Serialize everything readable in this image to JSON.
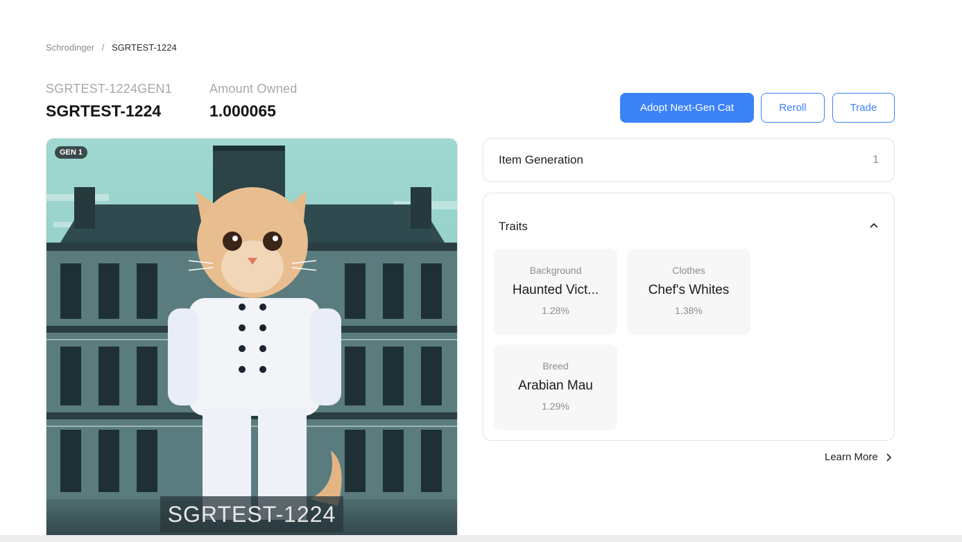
{
  "breadcrumb": {
    "root": "Schrodinger",
    "separator": "/",
    "current": "SGRTEST-1224"
  },
  "header": {
    "subtitle_left": "SGRTEST-1224GEN1",
    "title_left": "SGRTEST-1224",
    "subtitle_right": "Amount Owned",
    "amount": "1.000065"
  },
  "actions": {
    "adopt": "Adopt Next-Gen Cat",
    "reroll": "Reroll",
    "trade": "Trade"
  },
  "image": {
    "badge": "GEN 1",
    "caption": "SGRTEST-1224"
  },
  "item_generation": {
    "label": "Item Generation",
    "value": "1"
  },
  "traits": {
    "title": "Traits",
    "items": [
      {
        "name": "Background",
        "value": "Haunted Vict...",
        "percent": "1.28%"
      },
      {
        "name": "Clothes",
        "value": "Chef's Whites",
        "percent": "1.38%"
      },
      {
        "name": "Breed",
        "value": "Arabian Mau",
        "percent": "1.29%"
      }
    ]
  },
  "learn_more": "Learn More",
  "colors": {
    "accent": "#3b82f6",
    "muted": "#8c8c8c",
    "border": "#e3e3e3"
  },
  "icons": {
    "traits_toggle": "chevron-up-icon",
    "learn_more": "chevron-right-icon"
  }
}
